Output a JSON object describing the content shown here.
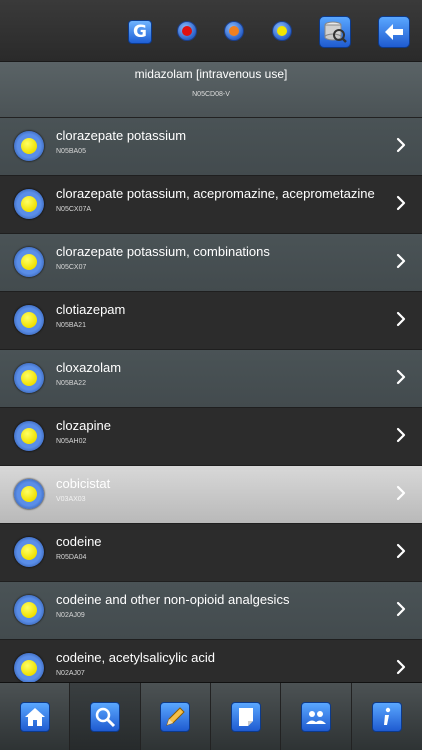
{
  "toolbar": {
    "g_label": "G",
    "dots": [
      {
        "name": "red",
        "color": "#e01010"
      },
      {
        "name": "orange",
        "color": "#f08020"
      },
      {
        "name": "yellow",
        "color": "#f3e600"
      }
    ],
    "icons": [
      "database-search-icon",
      "back-arrow-icon"
    ]
  },
  "header": {
    "title": "midazolam [intravenous use]",
    "code": "N05CD08-V"
  },
  "list": [
    {
      "name": "clorazepate potassium",
      "code": "N05BA05"
    },
    {
      "name": "clorazepate potassium, acepromazine, aceprometazine",
      "code": "N05CX07A"
    },
    {
      "name": "clorazepate potassium, combinations",
      "code": "N05CX07"
    },
    {
      "name": "clotiazepam",
      "code": "N05BA21"
    },
    {
      "name": "cloxazolam",
      "code": "N05BA22"
    },
    {
      "name": "clozapine",
      "code": "N05AH02"
    },
    {
      "name": "cobicistat",
      "code": "V03AX03"
    },
    {
      "name": "codeine",
      "code": "R05DA04"
    },
    {
      "name": "codeine and other non-opioid analgesics",
      "code": "N02AJ09"
    },
    {
      "name": "codeine, acetylsalicylic acid",
      "code": "N02AJ07"
    }
  ],
  "selected_index": 6,
  "colors": {
    "accent": "#2b6ee0",
    "bullet_core": "#f3e600"
  },
  "tabbar": {
    "tabs": [
      {
        "icon": "home-icon"
      },
      {
        "icon": "search-icon"
      },
      {
        "icon": "pencil-icon"
      },
      {
        "icon": "note-icon"
      },
      {
        "icon": "users-icon"
      },
      {
        "icon": "info-icon"
      }
    ],
    "active_index": 1
  }
}
